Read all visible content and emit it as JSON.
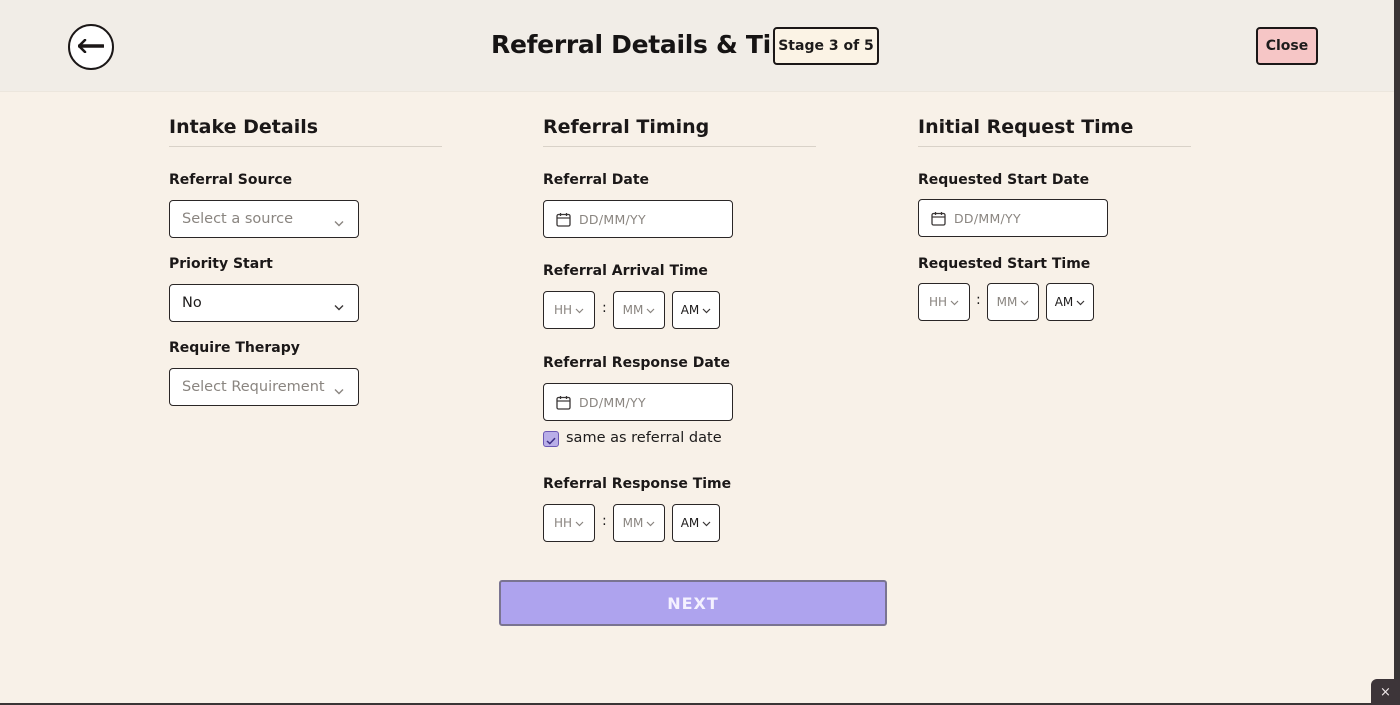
{
  "header": {
    "title": "Referral Details & Timing",
    "stage": "Stage 3 of 5",
    "close_label": "Close"
  },
  "intake": {
    "title": "Intake Details",
    "source_label": "Referral Source",
    "source_placeholder": "Select a source",
    "priority_label": "Priority Start",
    "priority_value": "No",
    "therapy_label": "Require Therapy",
    "therapy_placeholder": "Select Requirement"
  },
  "timing": {
    "title": "Referral Timing",
    "date_label": "Referral Date",
    "date_placeholder": "DD/MM/YY",
    "arrival_label": "Referral Arrival Time",
    "hour_placeholder": "HH",
    "minute_placeholder": "MM",
    "ampm": "AM",
    "colon": ":",
    "response_date_label": "Referral Response Date",
    "same_as_label": "same as referral date",
    "same_as_checked": true,
    "response_time_label": "Referral Response Time"
  },
  "initial": {
    "title": "Initial Request Time",
    "start_date_label": "Requested Start Date",
    "start_time_label": "Requested Start Time"
  },
  "footer": {
    "next_label": "NEXT",
    "corner_label": "×"
  },
  "colors": {
    "background": "#f8f1e8",
    "header": "#f1ede7",
    "close_button": "#f6c6c6",
    "next_button": "#aea3ee",
    "checkbox": "#b9aee8"
  }
}
